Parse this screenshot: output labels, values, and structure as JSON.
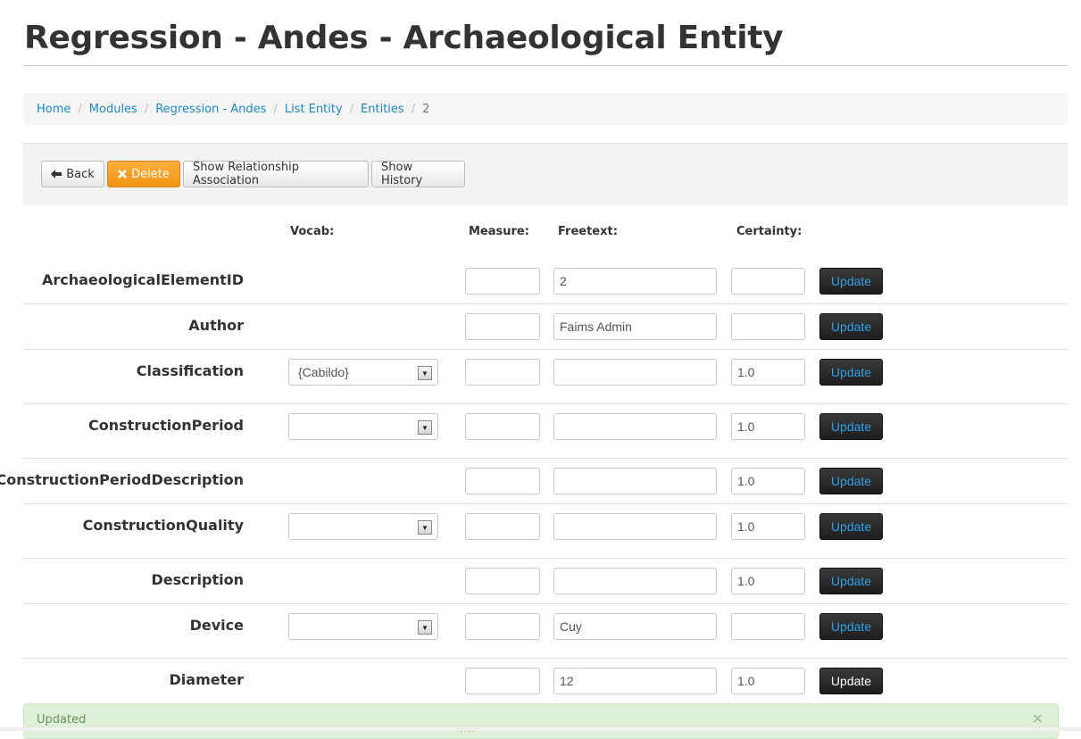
{
  "page": {
    "title": "Regression - Andes - Archaeological Entity"
  },
  "breadcrumb": {
    "items": [
      "Home",
      "Modules",
      "Regression - Andes",
      "List Entity",
      "Entities"
    ],
    "current": "2"
  },
  "toolbar": {
    "back_label": "Back",
    "delete_label": "Delete",
    "relationship_label": "Show Relationship Association",
    "history_label": "Show History"
  },
  "columns": {
    "vocab": "Vocab:",
    "measure": "Measure:",
    "freetext": "Freetext:",
    "certainty": "Certainty:"
  },
  "rows": [
    {
      "label": "ArchaeologicalElementID",
      "vocab": null,
      "measure": "",
      "freetext": "2",
      "certainty": "",
      "update": "Update"
    },
    {
      "label": "Author",
      "vocab": null,
      "measure": "",
      "freetext": "Faims Admin",
      "certainty": "",
      "update": "Update"
    },
    {
      "label": "Classification",
      "vocab": "{Cabildo}",
      "measure": "",
      "freetext": "",
      "certainty": "1.0",
      "update": "Update"
    },
    {
      "label": "ConstructionPeriod",
      "vocab": "",
      "measure": "",
      "freetext": "",
      "certainty": "1.0",
      "update": "Update"
    },
    {
      "label": "ConstructionPeriodDescription",
      "vocab": null,
      "measure": "",
      "freetext": "",
      "certainty": "1.0",
      "update": "Update"
    },
    {
      "label": "ConstructionQuality",
      "vocab": "",
      "measure": "",
      "freetext": "",
      "certainty": "1.0",
      "update": "Update"
    },
    {
      "label": "Description",
      "vocab": null,
      "measure": "",
      "freetext": "",
      "certainty": "1.0",
      "update": "Update"
    },
    {
      "label": "Device",
      "vocab": "",
      "measure": "",
      "freetext": "Cuy",
      "certainty": "",
      "update": "Update"
    },
    {
      "label": "Diameter",
      "vocab": null,
      "measure": "",
      "freetext": "12",
      "certainty": "1.0",
      "update": "Update"
    }
  ],
  "alert": {
    "message": "Updated",
    "close": "×"
  },
  "icons": {
    "back": "arrow-left-icon",
    "delete": "x-icon",
    "select": "chevron-down-icon"
  },
  "colors": {
    "accent": "#1e88c7",
    "delete": "#f29312",
    "update_text": "#2e9fe6",
    "alert_bg": "#dff0d8"
  }
}
